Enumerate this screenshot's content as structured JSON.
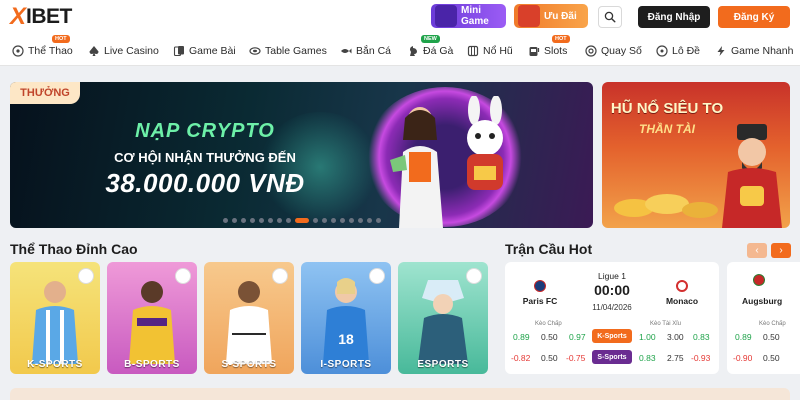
{
  "brand": {
    "logo_x": "X",
    "logo_text": "IBET"
  },
  "header": {
    "mini_game": "Mini Game",
    "uu_dai": "Ưu Đãi",
    "login": "Đăng Nhập",
    "register": "Đăng Ký"
  },
  "nav": {
    "items": [
      {
        "label": "Thể Thao",
        "badge": "HOT"
      },
      {
        "label": "Live Casino",
        "badge": ""
      },
      {
        "label": "Game Bài",
        "badge": ""
      },
      {
        "label": "Table Games",
        "badge": ""
      },
      {
        "label": "Bắn Cá",
        "badge": ""
      },
      {
        "label": "Đá Gà",
        "badge": "NEW"
      },
      {
        "label": "Nổ Hũ",
        "badge": ""
      },
      {
        "label": "Slots",
        "badge": "HOT"
      },
      {
        "label": "Quay Số",
        "badge": ""
      },
      {
        "label": "Lô Đề",
        "badge": ""
      },
      {
        "label": "Game Nhanh",
        "badge": ""
      }
    ]
  },
  "banner": {
    "tag": "THƯỞNG",
    "line1": "NẠP CRYPTO",
    "line2": "CƠ HỘI NHẬN THƯỞNG ĐẾN",
    "line3": "38.000.000 VNĐ",
    "slide_count": 17,
    "active_slide": 8
  },
  "side_banner": {
    "line1": "HŨ NỔ SIÊU TO",
    "line2": "THẦN TÀI"
  },
  "sports": {
    "title": "Thể Thao Đỉnh Cao",
    "cards": [
      {
        "label": "K-SPORTS"
      },
      {
        "label": "B-SPORTS"
      },
      {
        "label": "S-SPORTS"
      },
      {
        "label": "I-SPORTS"
      },
      {
        "label": "ESPORTS"
      }
    ]
  },
  "hot_matches": {
    "title": "Trận Cầu Hot",
    "prev": "‹",
    "next": "›",
    "match": {
      "league": "Ligue 1",
      "home": "Paris FC",
      "away": "Monaco",
      "time": "00:00",
      "date": "11/04/2026",
      "handicap_label": "Kèo Chấp",
      "overunder_label": "Kèo Tài Xỉu",
      "provider_k": "K-Sports",
      "provider_s": "S-Sports",
      "k_row": [
        "0.89",
        "0.50",
        "0.97",
        "1.00",
        "3.00",
        "0.83"
      ],
      "s_row": [
        "-0.82",
        "0.50",
        "-0.75",
        "0.83",
        "2.75",
        "-0.93"
      ]
    },
    "match2": {
      "home": "Augsburg",
      "handicap_label": "Kèo Chấp",
      "k_row": [
        "0.89",
        "0.50"
      ],
      "s_row": [
        "-0.90",
        "0.50"
      ]
    }
  }
}
